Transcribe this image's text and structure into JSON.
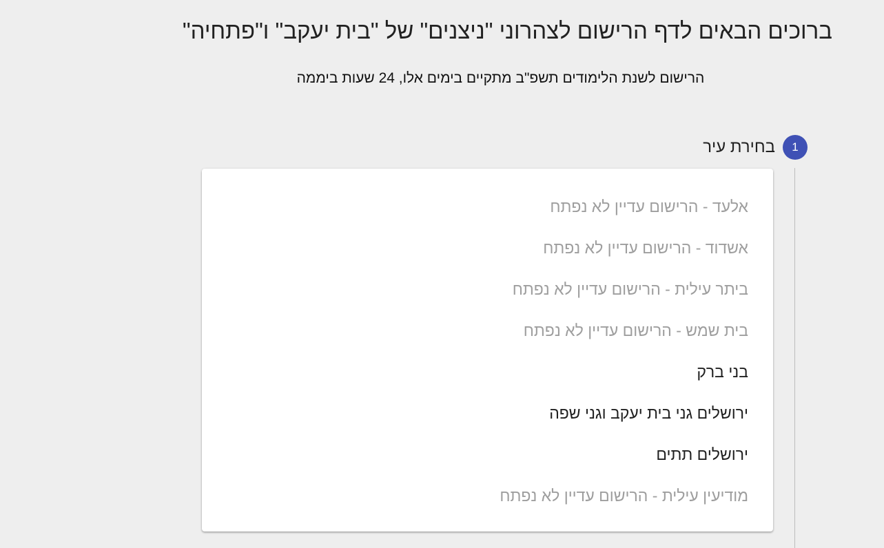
{
  "header": {
    "title": "ברוכים הבאים לדף הרישום לצהרוני \"ניצנים\" של \"בית יעקב\" ו\"פתחיה\"",
    "subtitle": "הרישום לשנת הלימודים תשפ\"ב מתקיים בימים אלו, 24 שעות ביממה"
  },
  "stepper": {
    "step": {
      "number": "1",
      "label": "בחירת עיר"
    }
  },
  "cities": [
    {
      "label": "אלעד - הרישום עדיין לא נפתח",
      "enabled": false
    },
    {
      "label": "אשדוד - הרישום עדיין לא נפתח",
      "enabled": false
    },
    {
      "label": "ביתר עילית - הרישום עדיין לא נפתח",
      "enabled": false
    },
    {
      "label": "בית שמש - הרישום עדיין לא נפתח",
      "enabled": false
    },
    {
      "label": "בני ברק",
      "enabled": true
    },
    {
      "label": "ירושלים גני בית יעקב וגני שפה",
      "enabled": true
    },
    {
      "label": "ירושלים תתים",
      "enabled": true
    },
    {
      "label": "מודיעין עילית - הרישום עדיין לא נפתח",
      "enabled": false
    }
  ],
  "colors": {
    "accent": "#3f51b5",
    "disabled_text": "#9e9e9e",
    "background": "#eeeeee"
  }
}
